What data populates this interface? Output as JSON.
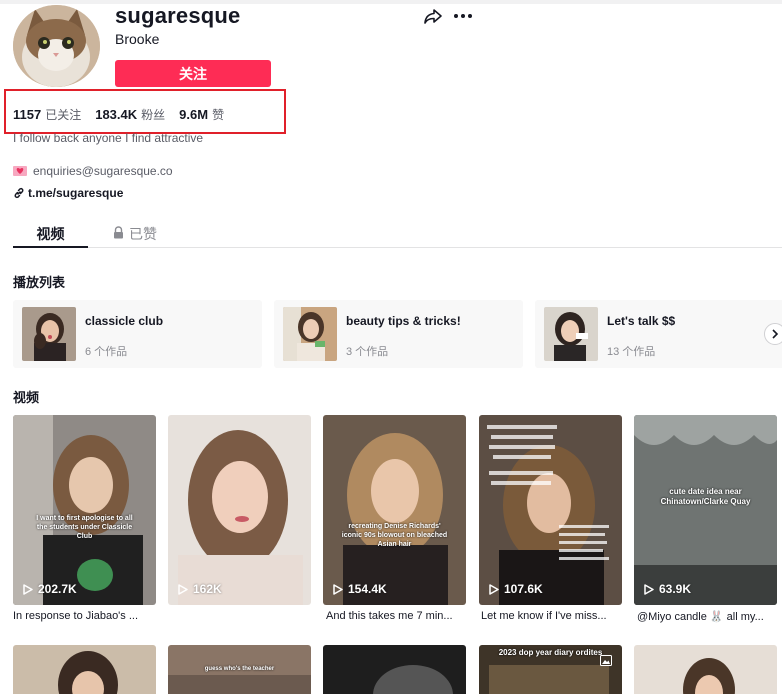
{
  "profile": {
    "username": "sugaresque",
    "nickname": "Brooke",
    "follow_label": "关注",
    "bio": "I follow back anyone I find attractive",
    "email": "enquiries@sugaresque.co",
    "link": "t.me/sugaresque"
  },
  "stats": [
    {
      "value": "1157",
      "label": "已关注"
    },
    {
      "value": "183.4K",
      "label": "粉丝"
    },
    {
      "value": "9.6M",
      "label": "赞"
    }
  ],
  "tabs": {
    "videos": "视频",
    "liked": "已赞"
  },
  "playlist_section_title": "播放列表",
  "playlists": [
    {
      "name": "classicle club",
      "count": "6 个作品"
    },
    {
      "name": "beauty tips & tricks!",
      "count": "3 个作品"
    },
    {
      "name": "Let's talk $$",
      "count": "13 个作品"
    }
  ],
  "videos_section_title": "视频",
  "videos": [
    {
      "views": "202.7K",
      "caption": "In response to Jiabao's ...",
      "overlay": "I want to first apologise to all the students under Classicle Club"
    },
    {
      "views": "162K",
      "caption": "",
      "overlay": ""
    },
    {
      "views": "154.4K",
      "caption": "And this takes me 7 min...",
      "overlay": "recreating Denise Richards' iconic 90s blowout on bleached Asian hair"
    },
    {
      "views": "107.6K",
      "caption": "Let me know if I've miss...",
      "overlay": ""
    },
    {
      "views": "63.9K",
      "caption": "@Miyo candle 🐰 all my...",
      "overlay": "cute date idea near Chinatown/Clarke Quay"
    }
  ],
  "row2_overlays": [
    "guess who's the teacher",
    "2023 dop year diary ordites"
  ],
  "colors": {
    "accent": "#fe2c55",
    "highlight_box": "#e0202a",
    "text_primary": "#161823",
    "text_secondary": "#5a5c66"
  }
}
